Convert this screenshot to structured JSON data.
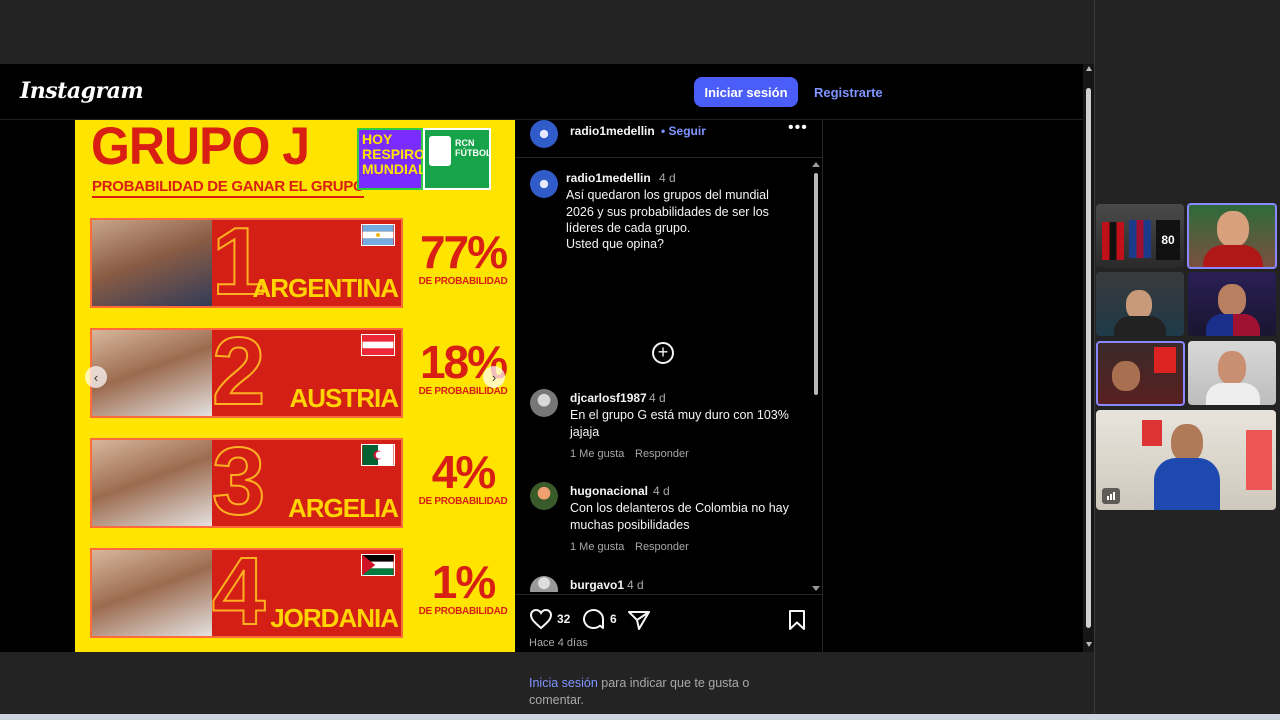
{
  "header": {
    "logo": "Instagram",
    "login_button": "Iniciar sesión",
    "register_link": "Registrarte"
  },
  "post_image": {
    "title": "GRUPO J",
    "subtitle": "PROBABILIDAD DE GANAR EL GRUPO",
    "brand_lines": [
      "HOY",
      "RESPIRO",
      "MUNDIAL"
    ],
    "brand_channel": "RCN FÚTBOL",
    "probability_label": "DE PROBABILIDAD",
    "teams": [
      {
        "rank": "1",
        "name": "ARGENTINA",
        "pct": "77%",
        "flag_colors": [
          "#74acdf",
          "#ffffff",
          "#74acdf"
        ]
      },
      {
        "rank": "2",
        "name": "AUSTRIA",
        "pct": "18%",
        "flag_colors": [
          "#ed2939",
          "#ffffff",
          "#ed2939"
        ]
      },
      {
        "rank": "3",
        "name": "ARGELIA",
        "pct": "4%",
        "flag_colors": [
          "#006233",
          "#ffffff",
          "#d21034"
        ]
      },
      {
        "rank": "4",
        "name": "JORDANIA",
        "pct": "1%",
        "flag_colors": [
          "#000000",
          "#ffffff",
          "#007a3d"
        ]
      }
    ]
  },
  "post": {
    "author": "radio1medellin",
    "follow": "• Seguir",
    "caption_author": "radio1medellin",
    "caption_age": "4 d",
    "caption_text": "Así quedaron los grupos del mundial 2026 y sus probabilidades de ser los líderes de cada grupo.",
    "caption_question": "Usted que opina?",
    "likes": "32",
    "comments_count": "6",
    "time_ago": "Hace 4 días",
    "login_link": "Inicia sesión",
    "login_rest": " para indicar que te gusta o comentar."
  },
  "comments": [
    {
      "user": "djcarlosf1987",
      "age": "4 d",
      "text": "En el grupo G está muy duro con 103% jajaja",
      "likes_label": "1 Me gusta",
      "reply_label": "Responder"
    },
    {
      "user": "hugonacional",
      "age": "4 d",
      "text": "Con los delanteros de Colombia no hay muchas posibilidades",
      "likes_label": "1 Me gusta",
      "reply_label": "Responder"
    },
    {
      "user": "burgavo1",
      "age": "4 d"
    }
  ],
  "call_tiles": {
    "jersey_number": "80",
    "colors": {
      "active_border": "#8a88ff"
    }
  },
  "colors": {
    "accent": "#4a5df9",
    "link": "#7f95ff",
    "poster_yellow": "#ffe400",
    "poster_red": "#d91e14"
  }
}
